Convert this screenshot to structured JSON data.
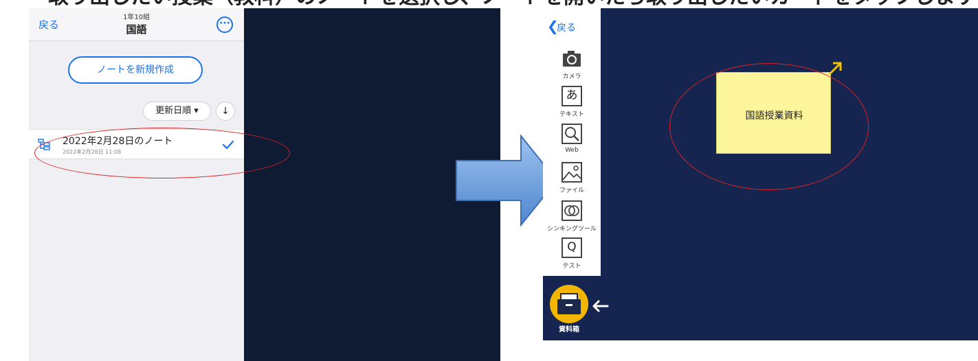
{
  "caption": "取り出したい授業（教科）のノートを選択し、ノートを開いたら取り出したいカードをタップします。",
  "left_app": {
    "header": {
      "back_label": "戻る",
      "class_label": "1年10組",
      "subject_label": "国語",
      "more_icon": "ellipsis-circle-icon"
    },
    "new_note_label": "ノートを新規作成",
    "sort": {
      "label": "更新日順 ▾",
      "direction_icon": "↓"
    },
    "notes": [
      {
        "title": "2022年2月28日のノート",
        "date": "2022年2月28日 11:08",
        "selected": true
      }
    ]
  },
  "right_app": {
    "back_label": "戻る",
    "tools": [
      {
        "label": "カメラ",
        "icon": "camera-icon"
      },
      {
        "label": "テキスト",
        "icon": "text-icon",
        "glyph": "あ"
      },
      {
        "label": "Web",
        "icon": "web-search-icon"
      },
      {
        "label": "ファイル",
        "icon": "file-image-icon"
      },
      {
        "label": "シンキングツール",
        "icon": "thinking-tool-icon"
      },
      {
        "label": "テスト",
        "icon": "test-icon",
        "glyph": "Q"
      }
    ],
    "card_text": "国語授業資料",
    "material_box_label": "資料箱"
  },
  "colors": {
    "accent": "#1a73e8",
    "dark_bg_left": "#0f1a33",
    "dark_bg_right": "#15254f",
    "sticky": "#fdf59b",
    "highlight": "#e02020",
    "material_box": "#f2b600"
  }
}
